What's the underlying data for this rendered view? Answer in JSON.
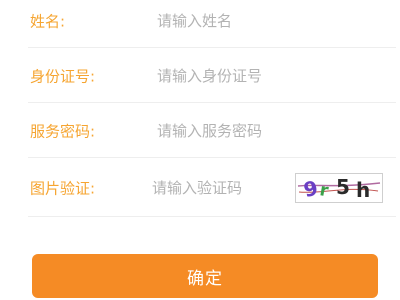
{
  "form": {
    "name": {
      "label": "姓名:",
      "placeholder": "请输入姓名",
      "value": ""
    },
    "id_number": {
      "label": "身份证号:",
      "placeholder": "请输入身份证号",
      "value": ""
    },
    "service_password": {
      "label": "服务密码:",
      "placeholder": "请输入服务密码",
      "value": ""
    },
    "captcha": {
      "label": "图片验证:",
      "placeholder": "请输入验证码",
      "value": "",
      "image_text": "9r5h"
    }
  },
  "submit_button": {
    "label": "确定"
  },
  "colors": {
    "label": "#f6a531",
    "placeholder": "#b3b3b3",
    "button": "#f58b25",
    "divider": "#eeeeee"
  }
}
